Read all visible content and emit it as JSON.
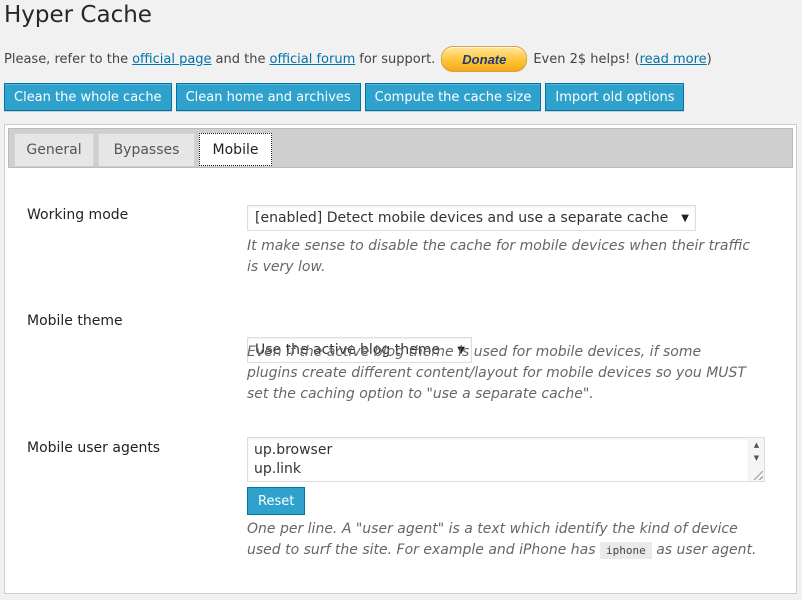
{
  "page": {
    "title": "Hyper Cache"
  },
  "support": {
    "prefix": "Please, refer to the",
    "official_page_link": "official page",
    "and_the": "and the",
    "official_forum_link": "official forum",
    "for_support": "for support.",
    "donate_label": "Donate",
    "helps_text": "Even 2$ helps! (",
    "read_more_link": "read more",
    "close_paren": ")"
  },
  "actions": {
    "clean_whole_cache": "Clean the whole cache",
    "clean_home_archives": "Clean home and archives",
    "compute_cache_size": "Compute the cache size",
    "import_old_options": "Import old options"
  },
  "tabs": [
    {
      "label": "General",
      "active": false
    },
    {
      "label": "Bypasses",
      "active": false
    },
    {
      "label": "Mobile",
      "active": true
    }
  ],
  "mobile": {
    "working_mode": {
      "label": "Working mode",
      "selected": "[enabled] Detect mobile devices and use a separate cache",
      "desc_line1": "It make sense to disable the cache for mobile devices when their traffic",
      "desc_line2": "is very low."
    },
    "mobile_theme": {
      "label": "Mobile theme",
      "selected": "Use the active blog theme",
      "desc_line1": "Even if the active blog theme is used for mobile devices, if some",
      "desc_line2": "plugins create different content/layout for mobile devices so you MUST",
      "desc_line3": "set the caching option to \"use a separate cache\"."
    },
    "user_agents": {
      "label": "Mobile user agents",
      "lines": [
        "up.browser",
        "up.link"
      ],
      "reset_label": "Reset",
      "desc_line1": "One per line. A \"user agent\" is a text which identify the kind of device",
      "desc_line2_prefix": "used to surf the site. For example and iPhone has",
      "desc_code": "iphone",
      "desc_line2_suffix": "as user agent."
    }
  },
  "colors": {
    "primary_button": "#2ea2cc",
    "link": "#0073aa",
    "donate": "#ffc439"
  }
}
